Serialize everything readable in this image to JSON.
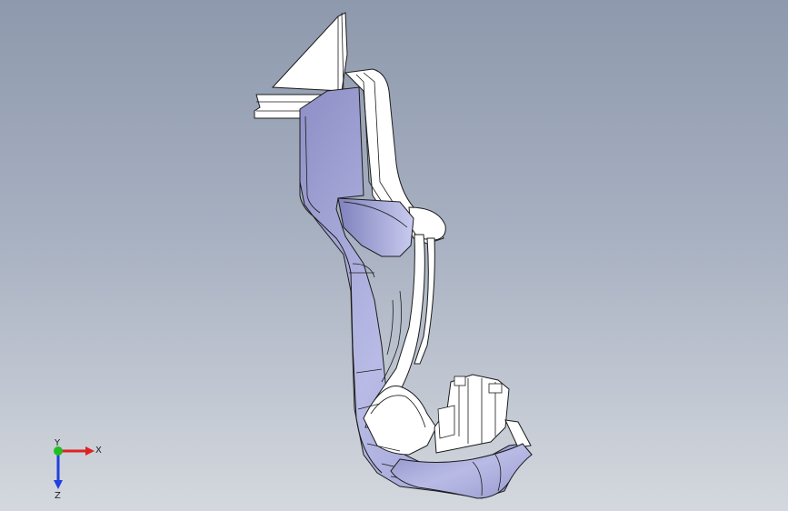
{
  "viewport": {
    "background_top": "#8e99ad",
    "background_bottom": "#d4d8de"
  },
  "model": {
    "shaded_color": "#a9aad6",
    "edge_color": "#1c1c1c",
    "highlight_color": "#ffffff"
  },
  "triad": {
    "x_label": "X",
    "y_label": "Y",
    "z_label": "Z",
    "x_color": "#e02020",
    "y_color": "#20c020",
    "z_color": "#2040e0"
  }
}
